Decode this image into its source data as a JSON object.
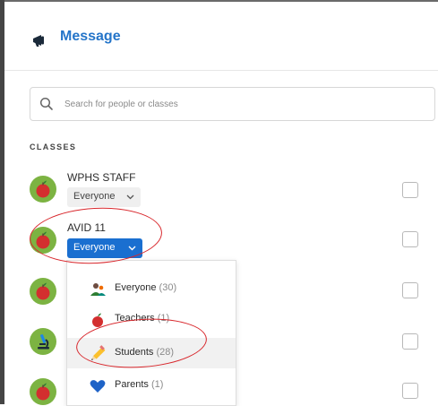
{
  "header": {
    "title": "Message",
    "icon": "megaphone-icon"
  },
  "search": {
    "placeholder": "Search for people or classes",
    "value": ""
  },
  "section_label": "CLASSES",
  "classes": [
    {
      "name": "WPHS STAFF",
      "audience": "Everyone",
      "icon": "apple-icon"
    },
    {
      "name": "AVID 11",
      "audience": "Everyone",
      "icon": "apple-icon"
    },
    {
      "icon": "apple-icon"
    },
    {
      "icon": "microscope-icon"
    },
    {
      "icon": "apple-icon"
    }
  ],
  "dropdown": {
    "items": [
      {
        "label": "Everyone",
        "count": "(30)",
        "icon": "people-icon"
      },
      {
        "label": "Teachers",
        "count": "(1)",
        "icon": "apple-icon"
      },
      {
        "label": "Students",
        "count": "(28)",
        "icon": "pencil-icon"
      },
      {
        "label": "Parents",
        "count": "(1)",
        "icon": "heart-icon"
      }
    ]
  },
  "colors": {
    "accent": "#2575c9",
    "button_blue": "#1a6fd0",
    "annotation_red": "#d8262b",
    "avatar_green": "#7cb342"
  }
}
